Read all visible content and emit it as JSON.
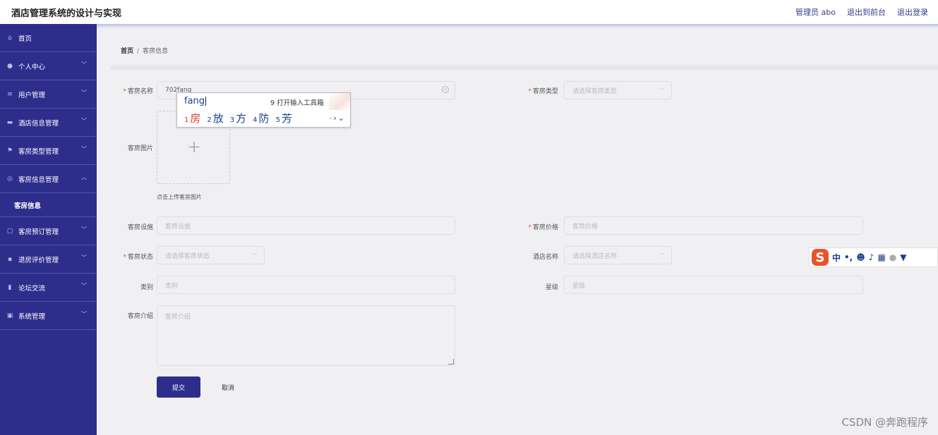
{
  "header": {
    "title": "酒店管理系统的设计与实现",
    "user_label": "管理员 abo",
    "front_link": "退出到前台",
    "logout_link": "退出登录"
  },
  "sidebar": {
    "items": [
      {
        "label": "首页",
        "icon": "home-icon"
      },
      {
        "label": "个人中心",
        "icon": "user-icon"
      },
      {
        "label": "用户管理",
        "icon": "menu-icon"
      },
      {
        "label": "酒店信息管理",
        "icon": "hotel-icon"
      },
      {
        "label": "客房类型管理",
        "icon": "flag-icon"
      },
      {
        "label": "客房信息管理",
        "icon": "info-icon"
      },
      {
        "label": "客房预订管理",
        "icon": "book-icon"
      },
      {
        "label": "退房评价管理",
        "icon": "comment-icon"
      },
      {
        "label": "论坛交流",
        "icon": "forum-icon"
      },
      {
        "label": "系统管理",
        "icon": "system-icon"
      }
    ],
    "sub_item": "客房信息"
  },
  "breadcrumb": {
    "home": "首页",
    "sep": "/",
    "current": "客房信息"
  },
  "form": {
    "room_name": {
      "label": "客房名称",
      "value": "702fang"
    },
    "room_type": {
      "label": "客房类型",
      "placeholder": "请选择客房类型"
    },
    "room_image": {
      "label": "客房图片",
      "tip": "点击上传客房图片"
    },
    "facility": {
      "label": "客房设施",
      "placeholder": "客房设施"
    },
    "price": {
      "label": "客房价格",
      "placeholder": "客房价格"
    },
    "status": {
      "label": "客房状态",
      "placeholder": "请选择客房状态"
    },
    "hotel_name": {
      "label": "酒店名称",
      "placeholder": "请选择酒店名称"
    },
    "category": {
      "label": "类别",
      "placeholder": "类别"
    },
    "star": {
      "label": "星级",
      "placeholder": "星级"
    },
    "intro": {
      "label": "客房介绍",
      "placeholder": "客房介绍"
    },
    "submit": "提交",
    "cancel": "取消"
  },
  "ime": {
    "composition": "fang",
    "toolbox": "9 打开输入工具箱",
    "candidates": [
      {
        "n": "1",
        "c": "房"
      },
      {
        "n": "2",
        "c": "放"
      },
      {
        "n": "3",
        "c": "方"
      },
      {
        "n": "4",
        "c": "防"
      },
      {
        "n": "5",
        "c": "芳"
      }
    ],
    "bar_logo": "S",
    "bar_mode": "中"
  },
  "watermark": "CSDN @奔跑程序"
}
